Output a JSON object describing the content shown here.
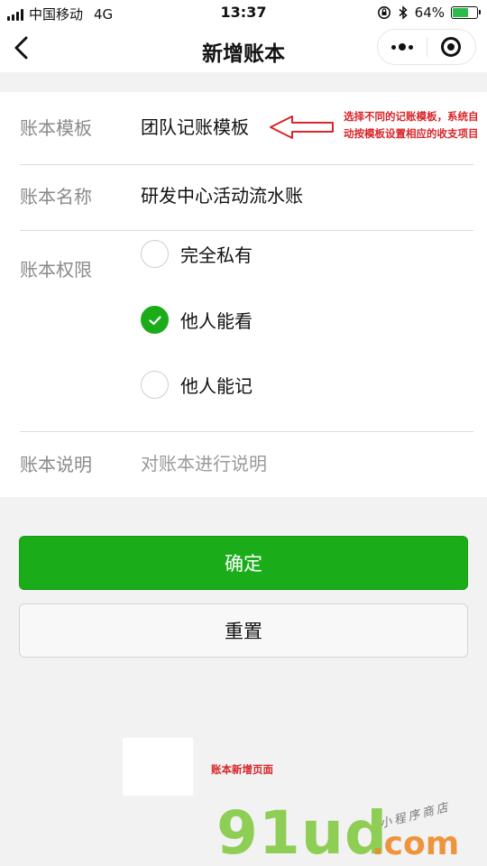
{
  "status_bar": {
    "carrier": "中国移动",
    "network": "4G",
    "time": "13:37",
    "battery_percent": "64%",
    "battery_level": 0.64,
    "battery_color": "#2dbb4a",
    "icons": [
      "signal-icon",
      "rotation-lock-icon",
      "bluetooth-icon",
      "battery-icon"
    ]
  },
  "nav": {
    "title": "新增账本",
    "back_icon": "chevron-left-icon",
    "more_icon": "more-dots-icon",
    "close_icon": "target-circle-icon"
  },
  "form": {
    "template": {
      "label": "账本模板",
      "value": "团队记账模板"
    },
    "name": {
      "label": "账本名称",
      "value": "研发中心活动流水账"
    },
    "permission": {
      "label": "账本权限",
      "options": [
        {
          "label": "完全私有",
          "checked": false
        },
        {
          "label": "他人能看",
          "checked": true
        },
        {
          "label": "他人能记",
          "checked": false
        }
      ]
    },
    "description": {
      "label": "账本说明",
      "placeholder": "对账本进行说明"
    }
  },
  "buttons": {
    "confirm": "确定",
    "reset": "重置"
  },
  "annotations": {
    "template_note": "选择不同的记账模板，系统自动按模板设置相应的收支项目",
    "page_caption": "账本新增页面"
  },
  "watermark": {
    "main": "91ud",
    "suffix": ".com",
    "tagline": "小程序商店"
  },
  "colors": {
    "accent": "#1aad19",
    "annotation": "#d8262a"
  }
}
